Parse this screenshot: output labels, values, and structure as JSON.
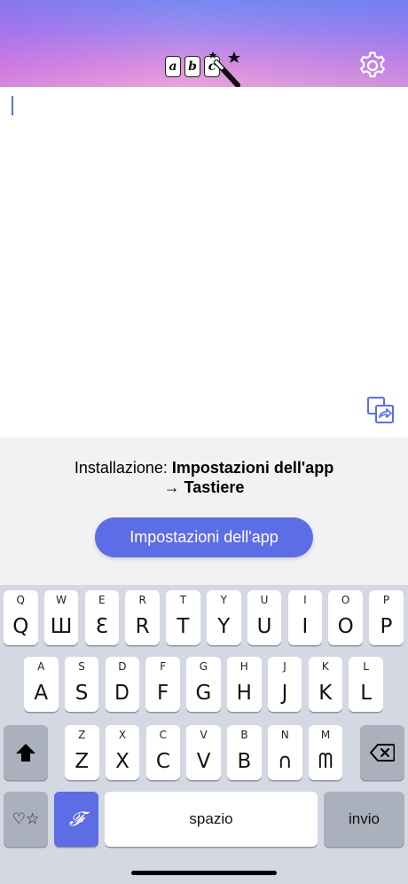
{
  "header": {
    "logo_letters": [
      "a",
      "b",
      "c"
    ],
    "logo_icon": "magic-wand-icon",
    "settings_icon": "gear-icon"
  },
  "editor": {
    "text": "",
    "share_icon": "share-copy-icon"
  },
  "install": {
    "prefix": "Installazione: ",
    "path_bold": "Impostazioni dell'app",
    "line2": "→ Tastiere",
    "button_label": "Impostazioni dell'app"
  },
  "keyboard": {
    "row1": [
      {
        "hint": "Q",
        "glyph": "Q"
      },
      {
        "hint": "W",
        "glyph": "Ш"
      },
      {
        "hint": "E",
        "glyph": "Ɛ"
      },
      {
        "hint": "R",
        "glyph": "R"
      },
      {
        "hint": "T",
        "glyph": "T"
      },
      {
        "hint": "Y",
        "glyph": "Y"
      },
      {
        "hint": "U",
        "glyph": "U"
      },
      {
        "hint": "I",
        "glyph": "I"
      },
      {
        "hint": "O",
        "glyph": "O"
      },
      {
        "hint": "P",
        "glyph": "P"
      }
    ],
    "row2": [
      {
        "hint": "A",
        "glyph": "A"
      },
      {
        "hint": "S",
        "glyph": "S"
      },
      {
        "hint": "D",
        "glyph": "Ꭰ"
      },
      {
        "hint": "F",
        "glyph": "F"
      },
      {
        "hint": "G",
        "glyph": "G"
      },
      {
        "hint": "H",
        "glyph": "H"
      },
      {
        "hint": "J",
        "glyph": "J"
      },
      {
        "hint": "K",
        "glyph": "K"
      },
      {
        "hint": "L",
        "glyph": "L"
      }
    ],
    "row3": [
      {
        "hint": "Z",
        "glyph": "Z"
      },
      {
        "hint": "X",
        "glyph": "X"
      },
      {
        "hint": "C",
        "glyph": "C"
      },
      {
        "hint": "V",
        "glyph": "V"
      },
      {
        "hint": "B",
        "glyph": "B"
      },
      {
        "hint": "N",
        "glyph": "∩"
      },
      {
        "hint": "M",
        "glyph": "ᗰ"
      }
    ],
    "shift_icon": "shift-arrow-icon",
    "backspace_icon": "backspace-icon",
    "symbols_label": "♡☆",
    "font_label": "𝓕",
    "space_label": "spazio",
    "return_label": "invio"
  }
}
